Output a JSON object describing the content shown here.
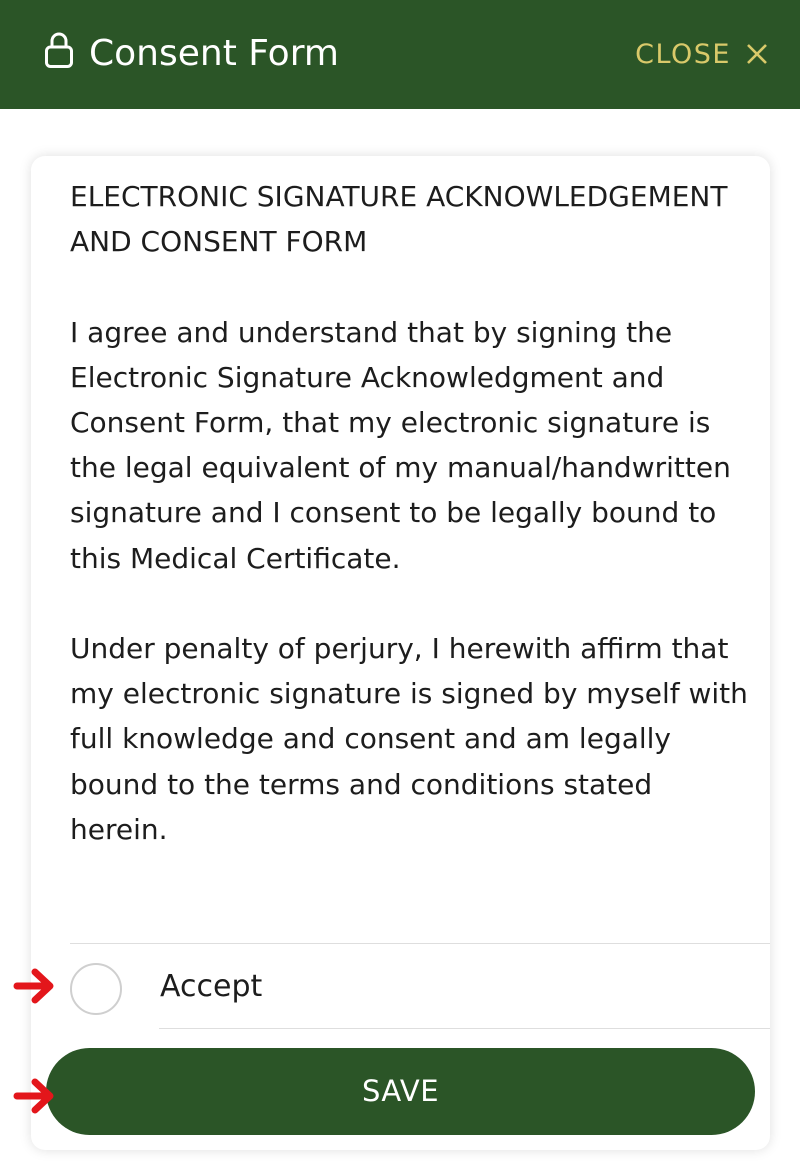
{
  "header": {
    "title": "Consent Form",
    "close_label": "CLOSE",
    "lock_icon": "lock-icon",
    "close_icon": "x-icon",
    "bg_color": "#2b5527",
    "close_color": "#d9c96a"
  },
  "form": {
    "heading": "ELECTRONIC SIGNATURE ACKNOWLEDGEMENT AND CONSENT FORM",
    "paragraph1": "I agree and understand that by signing the Electronic Signature Acknowledgment and Consent Form, that my electronic signature is the legal equivalent of my manual/handwritten signature and I consent to be legally bound to this Medical Certificate.",
    "paragraph2": "Under penalty of perjury, I herewith affirm that my electronic signature is signed by myself with full knowledge and consent and am legally bound to the terms and conditions stated herein.",
    "accept_label": "Accept",
    "accept_checked": false,
    "save_label": "SAVE"
  },
  "annotations": {
    "arrow_color": "#e3161b"
  }
}
